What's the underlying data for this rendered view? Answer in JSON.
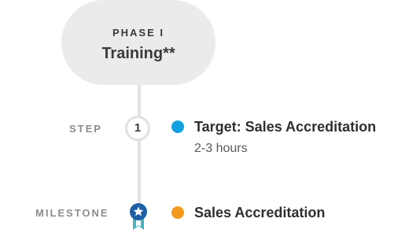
{
  "phase": {
    "label": "PHASE I",
    "title": "Training**"
  },
  "step": {
    "label": "STEP",
    "number": "1",
    "title": "Target: Sales Accreditation",
    "subtitle": "2-3 hours",
    "dot_color": "#12a1e0"
  },
  "milestone": {
    "label": "MILESTONE",
    "icon": "award-ribbon-icon",
    "title": "Sales Accreditation",
    "dot_color": "#f39a1e"
  },
  "colors": {
    "pill_bg": "#ebebeb",
    "line": "#e3e3e3",
    "badge_blue": "#1d5fa6",
    "ribbon_teal": "#3fb7c5"
  }
}
